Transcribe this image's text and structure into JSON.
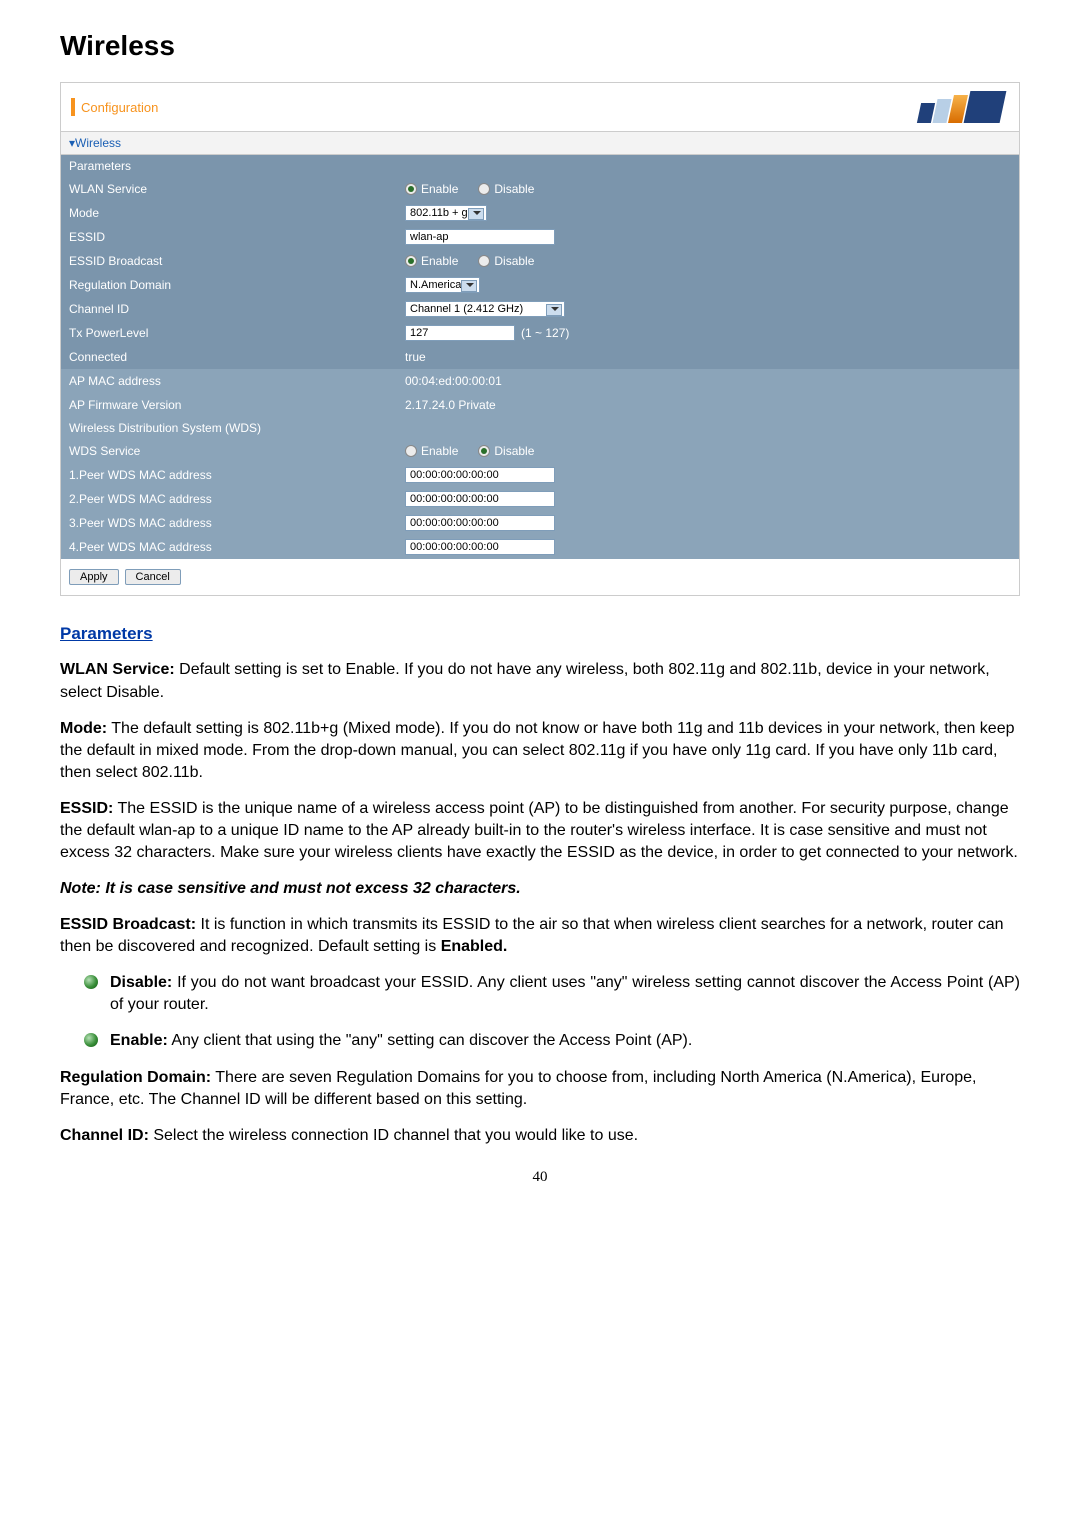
{
  "page_title": "Wireless",
  "panel": {
    "title": "Configuration",
    "section_wireless": "▾Wireless",
    "params_header": "Parameters",
    "rows": {
      "wlan_service": {
        "label": "WLAN Service",
        "enable": "Enable",
        "disable": "Disable"
      },
      "mode": {
        "label": "Mode",
        "value": "802.11b + g"
      },
      "essid": {
        "label": "ESSID",
        "value": "wlan-ap"
      },
      "essid_broadcast": {
        "label": "ESSID Broadcast",
        "enable": "Enable",
        "disable": "Disable"
      },
      "reg_domain": {
        "label": "Regulation Domain",
        "value": "N.America"
      },
      "channel_id": {
        "label": "Channel ID",
        "value": "Channel 1 (2.412 GHz)"
      },
      "tx_power": {
        "label": "Tx PowerLevel",
        "value": "127",
        "hint": "(1 ~ 127)"
      },
      "connected": {
        "label": "Connected",
        "value": "true"
      },
      "ap_mac": {
        "label": "AP MAC address",
        "value": "00:04:ed:00:00:01"
      },
      "ap_fw": {
        "label": "AP Firmware Version",
        "value": "2.17.24.0 Private"
      }
    },
    "wds_header": "Wireless Distribution System (WDS)",
    "wds": {
      "service": {
        "label": "WDS Service",
        "enable": "Enable",
        "disable": "Disable"
      },
      "p1": {
        "label": "1.Peer WDS MAC address",
        "value": "00:00:00:00:00:00"
      },
      "p2": {
        "label": "2.Peer WDS MAC address",
        "value": "00:00:00:00:00:00"
      },
      "p3": {
        "label": "3.Peer WDS MAC address",
        "value": "00:00:00:00:00:00"
      },
      "p4": {
        "label": "4.Peer WDS MAC address",
        "value": "00:00:00:00:00:00"
      }
    },
    "buttons": {
      "apply": "Apply",
      "cancel": "Cancel"
    }
  },
  "doc": {
    "params_heading": "Parameters",
    "wlan_b": "WLAN Service:",
    "wlan_t": " Default setting is set to Enable.  If you do not have any wireless, both 802.11g and 802.11b, device in your network, select Disable.",
    "mode_b": "Mode:",
    "mode_t": " The default setting is 802.11b+g (Mixed mode). If you do not know or have both 11g and 11b devices in your network, then keep the default in mixed mode.  From the drop-down manual, you can select 802.11g if you have only 11g card.  If you have only 11b card, then select 802.11b.",
    "essid_b": "ESSID:",
    "essid_t": " The ESSID is the unique name of a wireless access point (AP) to be distinguished from another.  For security purpose, change the default wlan-ap to a unique ID name to the AP already built-in to the router's wireless interface. It is case sensitive and must not excess 32 characters. Make sure your wireless clients have exactly the ESSID as the device, in order to get connected to your network.",
    "note": "Note: It is case sensitive and must not excess 32 characters.",
    "ebc_b": "ESSID Broadcast:",
    "ebc_t": "  It is function in which transmits its ESSID to the air so that when wireless client searches for a network, router can then be discovered and recognized. Default setting is ",
    "ebc_b2": "Enabled.",
    "disable_b": "Disable:",
    "disable_t": " If you do not want broadcast your ESSID.  Any client uses \"any\" wireless setting cannot discover the Access Point (AP) of your router.",
    "enable_b": "Enable:",
    "enable_t": " Any client that using the \"any\" setting can discover the Access Point (AP).",
    "reg_b": "Regulation Domain:",
    "reg_t": " There are seven Regulation Domains for you to choose from, including North America (N.America), Europe, France, etc. The Channel ID will be different based on this setting.",
    "chan_b": "Channel ID:",
    "chan_t": " Select the wireless connection ID channel that you would like to use.",
    "page_num": "40"
  }
}
